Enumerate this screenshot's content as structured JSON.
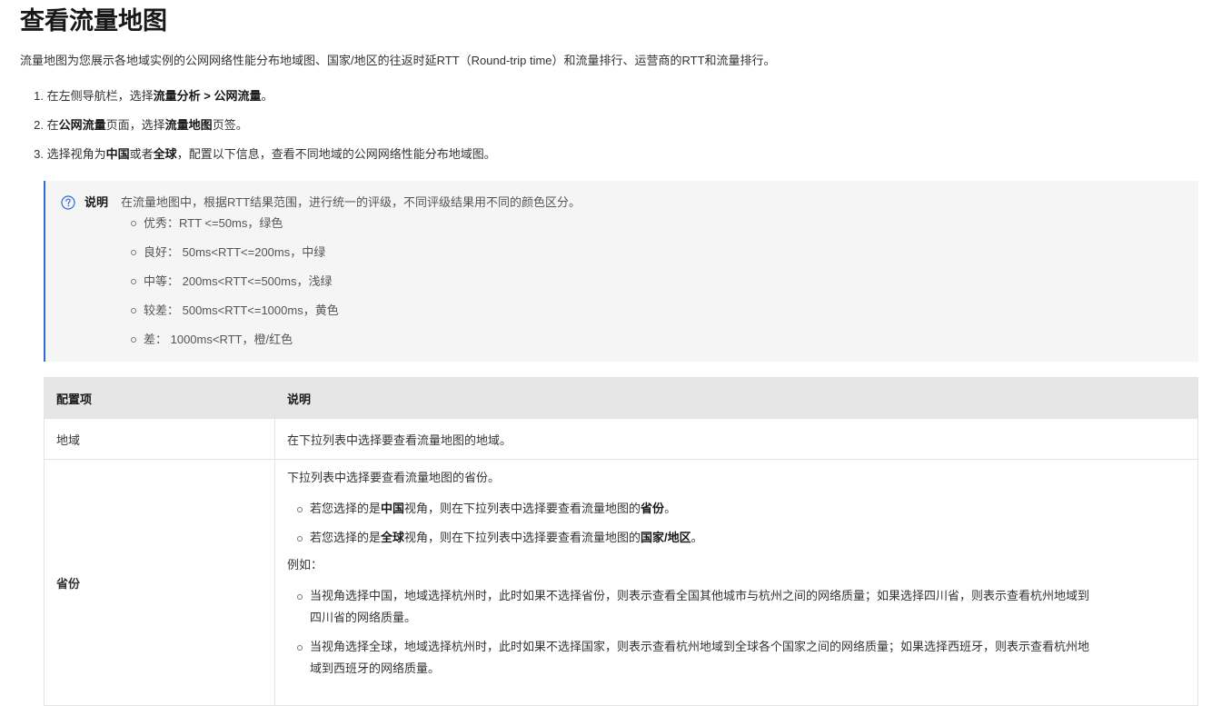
{
  "title": "查看流量地图",
  "intro": "流量地图为您展示各地域实例的公网网络性能分布地域图、国家/地区的往返时延RTT（Round-trip time）和流量排行、运营商的RTT和流量排行。",
  "steps": [
    {
      "num": "1.",
      "pre": "在左侧导航栏，选择",
      "b1": "流量分析 > 公网流量",
      "mid": "",
      "b2": "",
      "post": "。"
    },
    {
      "num": "2.",
      "pre": "在",
      "b1": "公网流量",
      "mid": "页面，选择",
      "b2": "流量地图",
      "post": "页签。"
    },
    {
      "num": "3.",
      "pre": "选择视角为",
      "b1": "中国",
      "mid": "或者",
      "b2": "全球",
      "post": "，配置以下信息，查看不同地域的公网网络性能分布地域图。"
    }
  ],
  "note": {
    "label": "说明",
    "text": "在流量地图中，根据RTT结果范围，进行统一的评级，不同评级结果用不同的颜色区分。",
    "items": [
      "优秀：RTT <=50ms，绿色",
      "良好： 50ms<RTT<=200ms，中绿",
      "中等： 200ms<RTT<=500ms，浅绿",
      "较差： 500ms<RTT<=1000ms，黄色",
      "差： 1000ms<RTT，橙/红色"
    ]
  },
  "table": {
    "headers": [
      "配置项",
      "说明"
    ],
    "region": {
      "name": "地域",
      "desc": "在下拉列表中选择要查看流量地图的地域。"
    },
    "province": {
      "name": "省份",
      "first": "下拉列表中选择要查看流量地图的省份。",
      "views": [
        {
          "pre": "若您选择的是",
          "b1": "中国",
          "mid": "视角，则在下拉列表中选择要查看流量地图的",
          "b2": "省份",
          "post": "。"
        },
        {
          "pre": "若您选择的是",
          "b1": "全球",
          "mid": "视角，则在下拉列表中选择要查看流量地图的",
          "b2": "国家/地区",
          "post": "。"
        }
      ],
      "example_label": "例如：",
      "examples": [
        {
          "line1": "当视角选择中国，地域选择杭州时，此时如果不选择省份，则表示查看全国其他城市与杭州之间的网络质量；如果选择四川省，则表示查看杭州地域到",
          "line2": "四川省的网络质量。"
        },
        {
          "line1": "当视角选择全球，地域选择杭州时，此时如果不选择国家，则表示查看杭州地域到全球各个国家之间的网络质量；如果选择西班牙，则表示查看杭州地",
          "line2": "域到西班牙的网络质量。"
        }
      ]
    }
  },
  "colors": {
    "accent": "#2f6bd8",
    "note_bg": "#f5f5f5",
    "header_bg": "#e6e6e6"
  },
  "icons": {
    "note": "question-circle-icon"
  }
}
